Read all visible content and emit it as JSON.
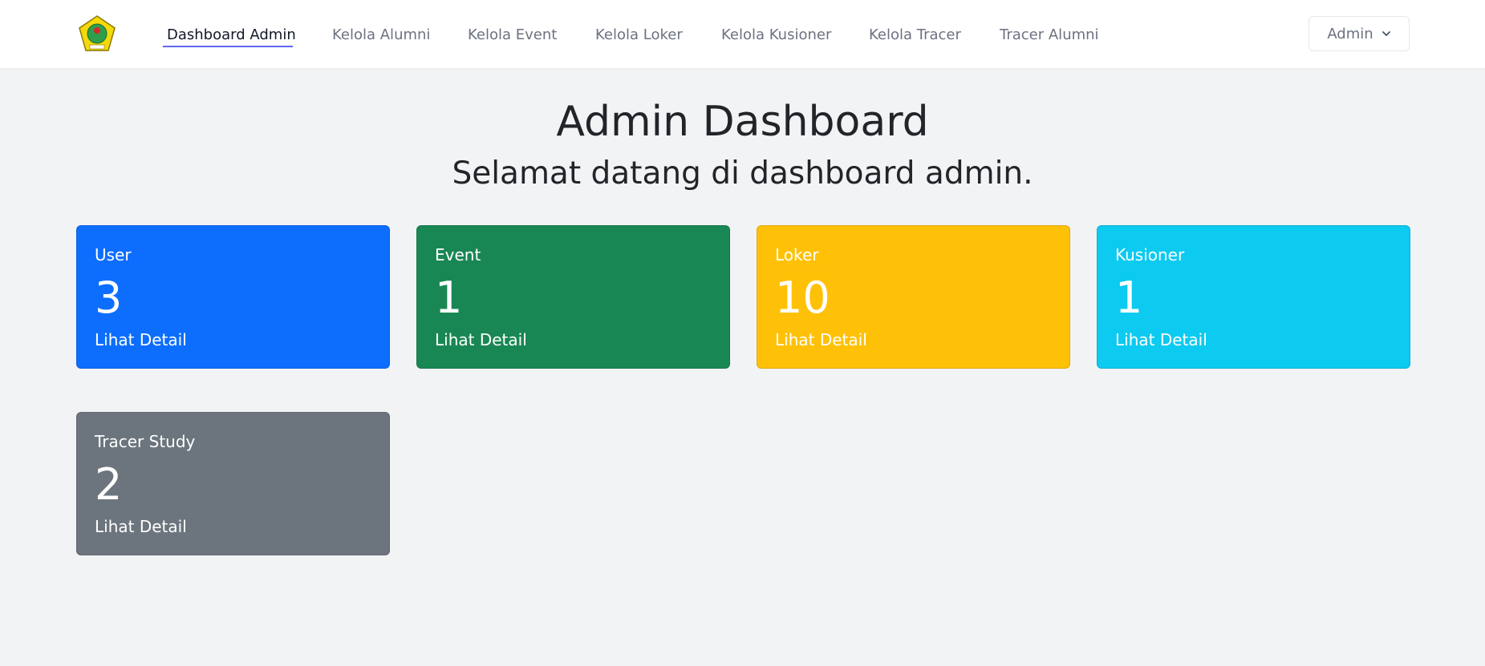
{
  "nav": {
    "links": [
      {
        "label": "Dashboard Admin",
        "active": true
      },
      {
        "label": "Kelola Alumni"
      },
      {
        "label": "Kelola Event"
      },
      {
        "label": "Kelola Loker"
      },
      {
        "label": "Kelola Kusioner"
      },
      {
        "label": "Kelola Tracer"
      },
      {
        "label": "Tracer Alumni"
      }
    ],
    "user_menu": {
      "label": "Admin",
      "icon": "chevron-down-icon"
    },
    "logo_icon": "institution-logo",
    "accent_color": "#6366f1"
  },
  "header": {
    "title": "Admin Dashboard",
    "subtitle": "Selamat datang di dashboard admin."
  },
  "cards": [
    {
      "title": "User",
      "count": "3",
      "link": "Lihat Detail",
      "color": "#0d6efd"
    },
    {
      "title": "Event",
      "count": "1",
      "link": "Lihat Detail",
      "color": "#198754"
    },
    {
      "title": "Loker",
      "count": "10",
      "link": "Lihat Detail",
      "color": "#ffc107"
    },
    {
      "title": "Kusioner",
      "count": "1",
      "link": "Lihat Detail",
      "color": "#0dcaf0"
    },
    {
      "title": "Tracer Study",
      "count": "2",
      "link": "Lihat Detail",
      "color": "#6c757d"
    }
  ]
}
